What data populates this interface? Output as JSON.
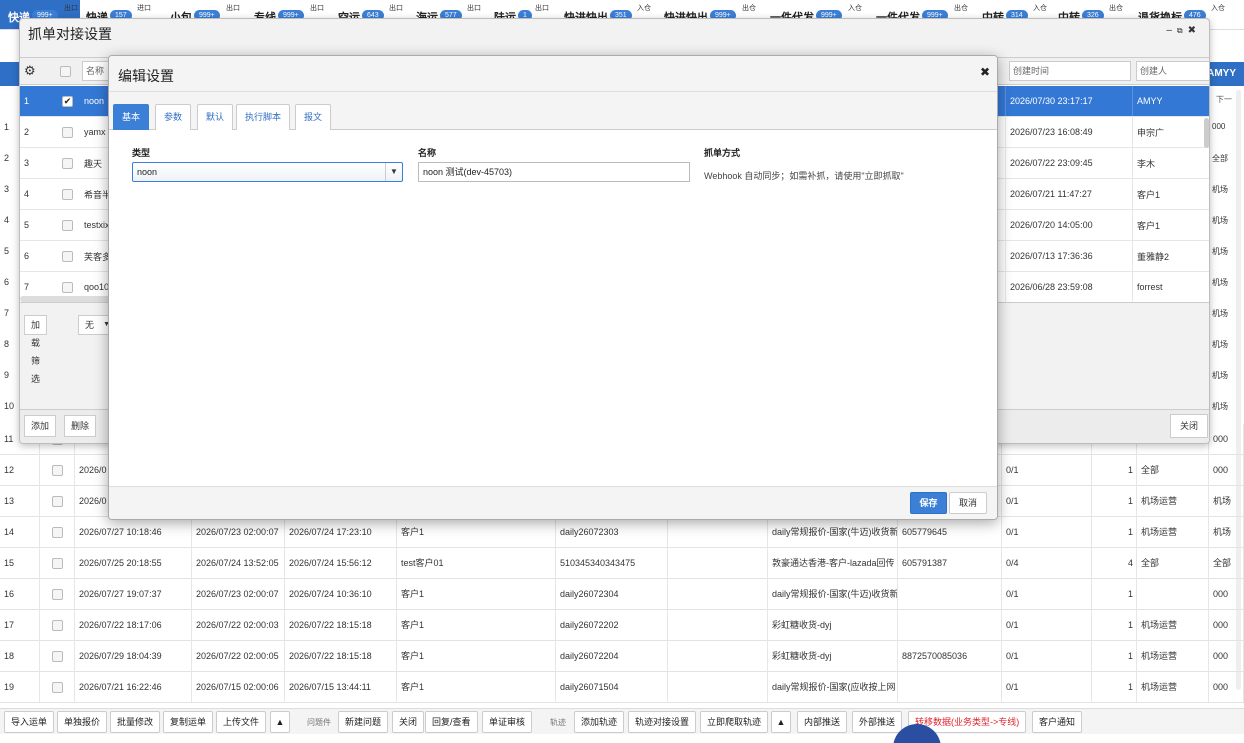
{
  "top_tabs": [
    {
      "label": "快递",
      "badge": "999+",
      "dir": "出口"
    },
    {
      "label": "快递",
      "badge": "157",
      "dir": "进口"
    },
    {
      "label": "小包",
      "badge": "999+",
      "dir": "出口"
    },
    {
      "label": "专线",
      "badge": "999+",
      "dir": "出口"
    },
    {
      "label": "空运",
      "badge": "643",
      "dir": "出口"
    },
    {
      "label": "海运",
      "badge": "577",
      "dir": "出口"
    },
    {
      "label": "陆运",
      "badge": "1",
      "dir": "出口"
    },
    {
      "label": "快进快出",
      "badge": "351",
      "dir": "入仓"
    },
    {
      "label": "快进快出",
      "badge": "999+",
      "dir": "出仓"
    },
    {
      "label": "一件代发",
      "badge": "999+",
      "dir": "入仓"
    },
    {
      "label": "一件代发",
      "badge": "999+",
      "dir": "出仓"
    },
    {
      "label": "中转",
      "badge": "314",
      "dir": "入仓"
    },
    {
      "label": "中转",
      "badge": "326",
      "dir": "出仓"
    },
    {
      "label": "退货换标",
      "badge": "476",
      "dir": "入仓"
    }
  ],
  "bg_user": "AMYY",
  "bg_next": "下一",
  "background_rows": [
    {
      "n": "11",
      "c1": "",
      "c2": "",
      "c3": "",
      "c4": "",
      "c5": "",
      "c6": "",
      "c7": "",
      "c8": "",
      "c9": "",
      "c10": "",
      "c11": "000"
    },
    {
      "n": "12",
      "c1": "2026/0",
      "c2": "",
      "c3": "",
      "c4": "",
      "c5": "",
      "c6": "",
      "c7": "",
      "c8": "0/1",
      "c9": "1",
      "c10": "全部",
      "c11": "000"
    },
    {
      "n": "13",
      "c1": "2026/0",
      "c2": "",
      "c3": "",
      "c4": "",
      "c5": "",
      "c6": "",
      "c7": "",
      "c8": "0/1",
      "c9": "1",
      "c10": "机场运营",
      "c11": "机场"
    },
    {
      "n": "14",
      "c1": "2026/07/27 10:18:46",
      "c2": "2026/07/23 02:00:07",
      "c3": "2026/07/24 17:23:10",
      "c4": "客户1",
      "c5": "daily26072303",
      "c6": "daily常规报价-国家(牛迈)收货新",
      "c7": "605779645",
      "c8": "0/1",
      "c9": "1",
      "c10": "机场运营",
      "c11": "机场"
    },
    {
      "n": "15",
      "c1": "2026/07/25 20:18:55",
      "c2": "2026/07/24 13:52:05",
      "c3": "2026/07/24 15:56:12",
      "c4": "test客户01",
      "c5": "510345340343475",
      "c6": "敦豪通达香港-客户-lazada回传",
      "c7": "605791387",
      "c8": "0/4",
      "c9": "4",
      "c10": "全部",
      "c11": "全部"
    },
    {
      "n": "16",
      "c1": "2026/07/27 19:07:37",
      "c2": "2026/07/23 02:00:07",
      "c3": "2026/07/24 10:36:10",
      "c4": "客户1",
      "c5": "daily26072304",
      "c6": "daily常规报价-国家(牛迈)收货新",
      "c7": "",
      "c8": "0/1",
      "c9": "1",
      "c10": "",
      "c11": "000"
    },
    {
      "n": "17",
      "c1": "2026/07/22 18:17:06",
      "c2": "2026/07/22 02:00:03",
      "c3": "2026/07/22 18:15:18",
      "c4": "客户1",
      "c5": "daily26072202",
      "c6": "彩虹糖收货-dyj",
      "c7": "",
      "c8": "0/1",
      "c9": "1",
      "c10": "机场运营",
      "c11": "000"
    },
    {
      "n": "18",
      "c1": "2026/07/29 18:04:39",
      "c2": "2026/07/22 02:00:05",
      "c3": "2026/07/22 18:15:18",
      "c4": "客户1",
      "c5": "daily26072204",
      "c6": "彩虹糖收货-dyj",
      "c7": "8872570085036",
      "c8": "0/1",
      "c9": "1",
      "c10": "机场运营",
      "c11": "000"
    },
    {
      "n": "19",
      "c1": "2026/07/21 16:22:46",
      "c2": "2026/07/15 02:00:06",
      "c3": "2026/07/15 13:44:11",
      "c4": "客户1",
      "c5": "daily26071504",
      "c6": "daily常规报价-国家(应收按上网",
      "c7": "",
      "c8": "0/1",
      "c9": "1",
      "c10": "机场运营",
      "c11": "000"
    }
  ],
  "bg_left_numbers": [
    "1",
    "2",
    "3",
    "4",
    "5",
    "6",
    "7",
    "8",
    "9",
    "10"
  ],
  "bg_right_col": [
    "000",
    "全部",
    "机场",
    "机场",
    "机场",
    "机场",
    "机场",
    "机场",
    "机场",
    "机场"
  ],
  "bottom_toolbar": {
    "import": "导入运单",
    "single_quote": "单独报价",
    "batch_edit": "批量修改",
    "copy": "复制运单",
    "upload": "上传文件",
    "issues_label": "问题件",
    "new_issue": "新建问题",
    "close": "关闭",
    "reply": "回复/查看",
    "audit": "单证审核",
    "track_label": "轨迹",
    "add_track": "添加轨迹",
    "track_settings": "轨迹对接设置",
    "pull_track": "立即爬取轨迹",
    "internal_push": "内部推送",
    "external_push": "外部推送",
    "transfer": "转移数据(业务类型->专线)",
    "notify": "客户通知"
  },
  "outer_dialog": {
    "title": "抓单对接设置",
    "header": {
      "name_col": "名称",
      "created_time": "创建时间",
      "creator": "创建人"
    },
    "rows": [
      {
        "n": "1",
        "name": "noon",
        "time": "2026/07/30 23:17:17",
        "user": "AMYY",
        "selected": true
      },
      {
        "n": "2",
        "name": "yamx",
        "time": "2026/07/23 16:08:49",
        "user": "申宗广",
        "selected": false
      },
      {
        "n": "3",
        "name": "趣天",
        "time": "2026/07/22 23:09:45",
        "user": "李木",
        "selected": false
      },
      {
        "n": "4",
        "name": "希音半",
        "time": "2026/07/21 11:47:27",
        "user": "客户1",
        "selected": false
      },
      {
        "n": "5",
        "name": "testxix",
        "time": "2026/07/20 14:05:00",
        "user": "客户1",
        "selected": false
      },
      {
        "n": "6",
        "name": "芙客多",
        "time": "2026/07/13 17:36:36",
        "user": "董雅静2",
        "selected": false
      },
      {
        "n": "7",
        "name": "qoo10",
        "time": "2026/06/28 23:59:08",
        "user": "forrest",
        "selected": false
      }
    ],
    "filter_btn": "加载筛选",
    "filter_select": "无",
    "add_btn": "添加",
    "delete_btn": "删除",
    "close_btn": "关闭"
  },
  "inner_dialog": {
    "title": "编辑设置",
    "tabs": [
      "基本",
      "参数",
      "默认",
      "执行脚本",
      "报文"
    ],
    "active_tab": 0,
    "type_label": "类型",
    "type_value": "noon",
    "name_label": "名称",
    "name_value": "noon 测试(dev-45703)",
    "method_label": "抓单方式",
    "method_text": "Webhook 自动同步；如需补抓，请使用\"立即抓取\"",
    "save_btn": "保存",
    "cancel_btn": "取消"
  },
  "colors": {
    "accent": "#3b7fd6",
    "header_blue": "#2f6fc5",
    "transfer_red": "#e0242c"
  }
}
